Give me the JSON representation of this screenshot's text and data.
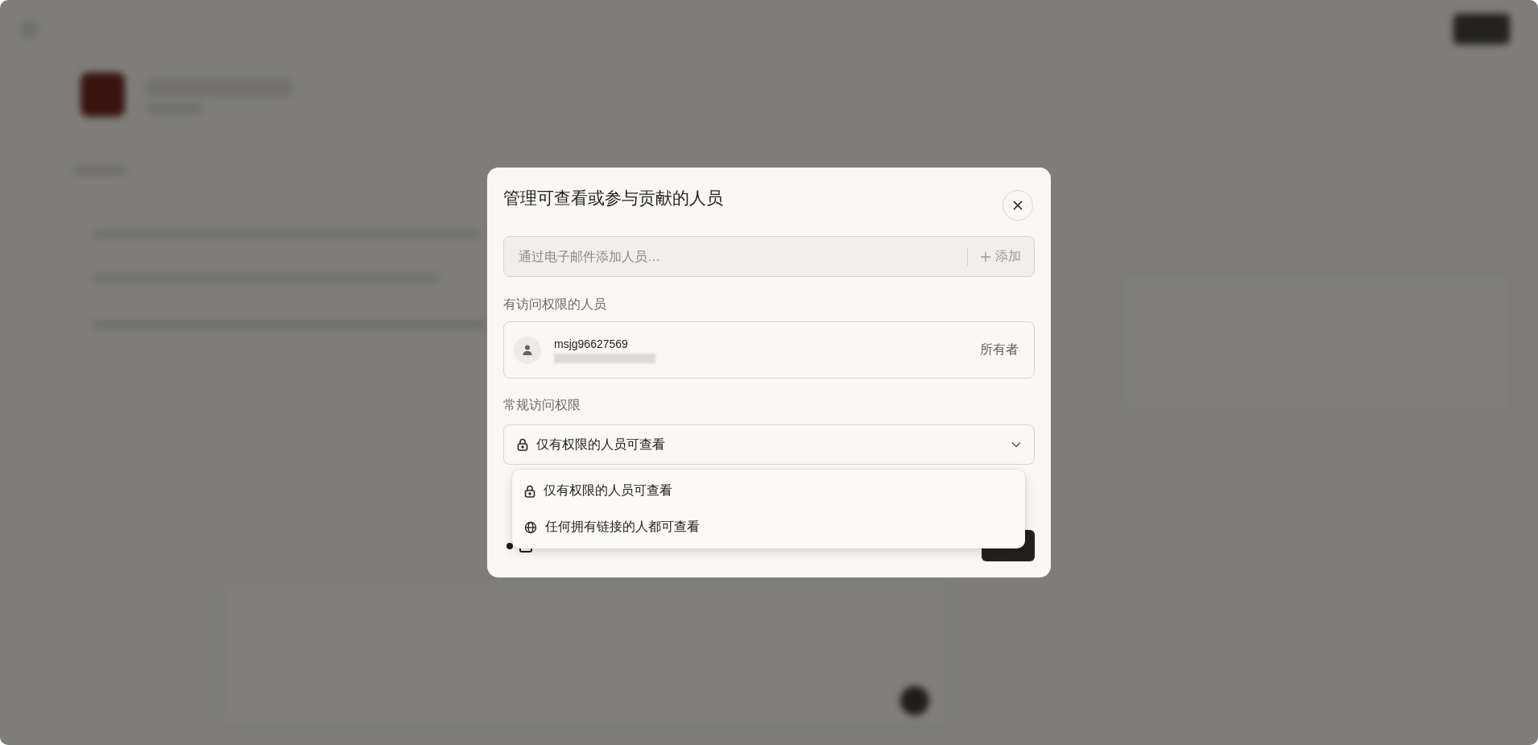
{
  "dialog": {
    "title": "管理可查看或参与贡献的人员",
    "email_field": {
      "placeholder": "通过电子邮件添加人员…",
      "add_button": "添加"
    },
    "people_label": "有访问权限的人员",
    "people": [
      {
        "name": "msjg96627569",
        "role": "所有者"
      }
    ],
    "general_access_label": "常规访问权限",
    "general_access": {
      "value": "仅有权限的人员可查看",
      "kind": "lock",
      "expanded": true
    },
    "access_options": [
      {
        "label": "仅有权限的人员可查看",
        "kind": "lock"
      },
      {
        "label": "任何拥有链接的人都可查看",
        "kind": "globe"
      }
    ]
  }
}
